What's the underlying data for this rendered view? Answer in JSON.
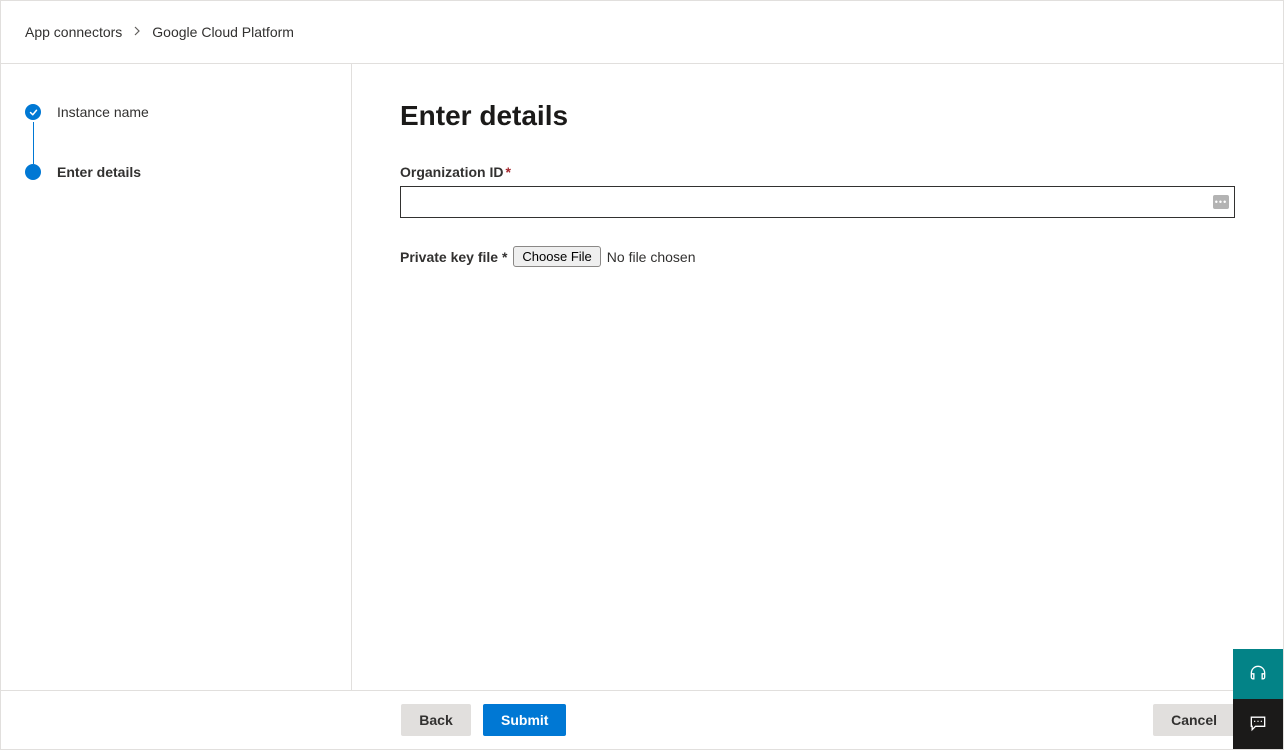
{
  "breadcrumb": {
    "parent": "App connectors",
    "current": "Google Cloud Platform"
  },
  "sidebar": {
    "steps": [
      {
        "label": "Instance name",
        "state": "completed"
      },
      {
        "label": "Enter details",
        "state": "current"
      }
    ]
  },
  "main": {
    "title": "Enter details",
    "org_id_label": "Organization ID",
    "org_id_value": "",
    "private_key_label": "Private key file",
    "choose_file_label": "Choose File",
    "no_file_text": "No file chosen"
  },
  "footer": {
    "back": "Back",
    "submit": "Submit",
    "cancel": "Cancel"
  },
  "widgets": {
    "help": "Help",
    "feedback": "Feedback"
  }
}
